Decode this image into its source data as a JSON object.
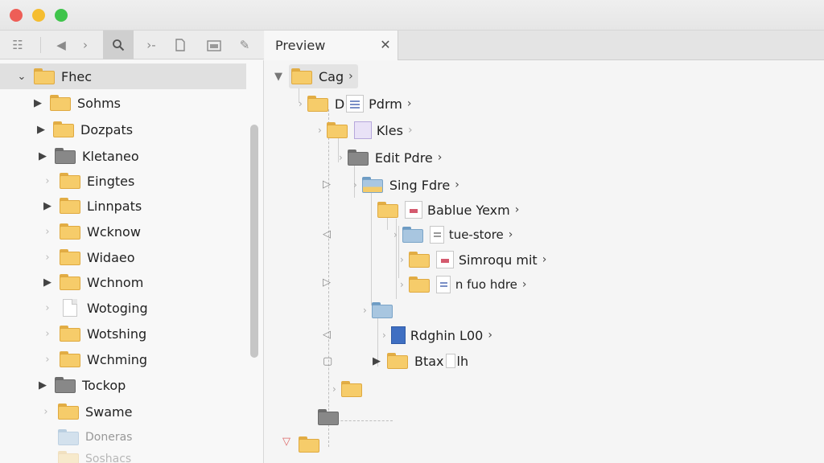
{
  "window": {
    "controls": [
      "close",
      "minimize",
      "zoom"
    ]
  },
  "toolbar": {
    "icons": [
      "list-icon",
      "back-icon",
      "forward-icon",
      "search-icon",
      "terminal-icon",
      "document-icon",
      "folder-icon",
      "pin-icon"
    ]
  },
  "sidebar": {
    "items": [
      {
        "label": "Fhec",
        "icon": "folder-yellow",
        "arrow": "⌄",
        "selected": true
      },
      {
        "label": "Sohms",
        "icon": "folder-yellow",
        "arrow": "▶"
      },
      {
        "label": "Dozpats",
        "icon": "folder-yellow",
        "arrow": "▶"
      },
      {
        "label": "Kletaneo",
        "icon": "folder-gray",
        "arrow": "▶"
      },
      {
        "label": "Eingtes",
        "icon": "folder-yellow",
        "arrow": "›"
      },
      {
        "label": "Linnpats",
        "icon": "folder-yellow",
        "arrow": "▶"
      },
      {
        "label": "Wcknow",
        "icon": "folder-yellow",
        "arrow": "›"
      },
      {
        "label": "Widaeo",
        "icon": "folder-yellow",
        "arrow": "›"
      },
      {
        "label": "Wchnom",
        "icon": "folder-yellow",
        "arrow": "▶"
      },
      {
        "label": "Wotoging",
        "icon": "document",
        "arrow": "›"
      },
      {
        "label": "Wotshing",
        "icon": "folder-yellow",
        "arrow": "›"
      },
      {
        "label": "Wchming",
        "icon": "folder-yellow",
        "arrow": "›"
      },
      {
        "label": "Tockop",
        "icon": "folder-gray",
        "arrow": "▶"
      },
      {
        "label": "Swame",
        "icon": "folder-yellow",
        "arrow": "›"
      },
      {
        "label": "Doneras",
        "icon": "folder-blue",
        "arrow": ""
      },
      {
        "label": "Soshacs",
        "icon": "folder-yellow",
        "arrow": ""
      }
    ]
  },
  "tab": {
    "label": "Preview",
    "close": "✕"
  },
  "preview": {
    "nodes": [
      {
        "label": "Cag",
        "icon": "folder-yellow"
      },
      {
        "label": "D",
        "label2": "Pdrm",
        "icon": "folder-yellow",
        "badge": "doc-lines"
      },
      {
        "label": "Kles",
        "icon": "folder-yellow",
        "badge": "purple"
      },
      {
        "label": "Edit Pdre",
        "icon": "folder-gray"
      },
      {
        "label": "Sing Fdre",
        "icon": "folder-open"
      },
      {
        "label": "Bablue Yexm",
        "icon": "folder-yellow",
        "badge": "doc-red"
      },
      {
        "label": "tue-store",
        "icon": "folder-blue",
        "badge": "doc-lines"
      },
      {
        "label": "Simroqu mit",
        "icon": "folder-yellow",
        "badge": "doc-red"
      },
      {
        "label": "n fuo hdre",
        "icon": "folder-yellow",
        "badge": "doc-lines"
      },
      {
        "label": "Rdghin L00",
        "icon": "doc-blue"
      },
      {
        "label": "Btax",
        "label2": "lh",
        "icon": "folder-yellow"
      }
    ]
  }
}
